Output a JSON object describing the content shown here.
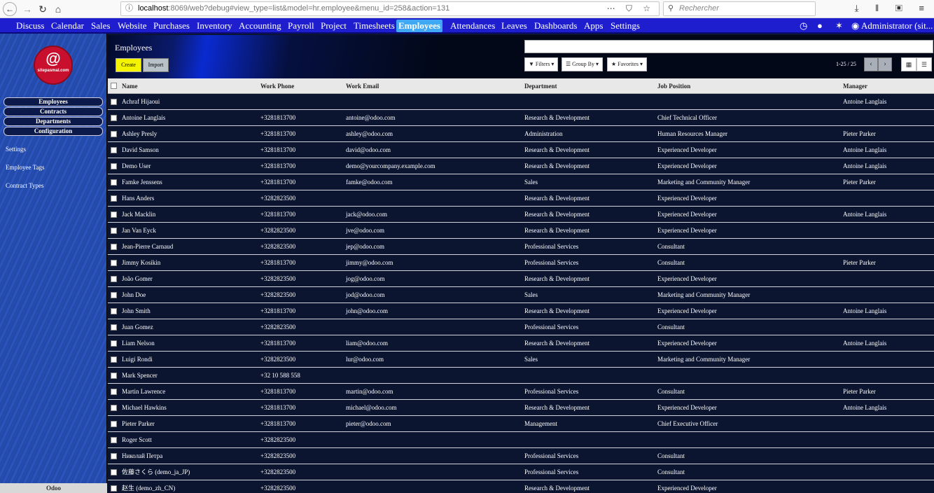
{
  "browser": {
    "url_host": "localhost",
    "url_rest": ":8069/web?debug#view_type=list&model=hr.employee&menu_id=258&action=131",
    "search_placeholder": "Rechercher",
    "urlbar_icons": "⋯ ⛉ ☆",
    "right_icons": "⤓ ‖ ▣ ≡"
  },
  "topmenu": {
    "apps": [
      "Discuss",
      "Calendar",
      "Sales",
      "Website",
      "Purchases",
      "Inventory",
      "Accounting",
      "Payroll",
      "Project",
      "Timesheets",
      "Employees",
      "Attendances",
      "Leaves",
      "Dashboards",
      "Apps",
      "Settings"
    ],
    "active": "Employees",
    "user": "Administrator (sit..."
  },
  "sidebar": {
    "logo_at": "@",
    "logo_text": "sitepasmal.com",
    "menu_buttons": [
      "Employees",
      "Contracts",
      "Departments",
      "Configuration"
    ],
    "links": [
      "Settings",
      "Employee Tags",
      "Contract Types"
    ],
    "footer": "Odoo"
  },
  "control_panel": {
    "title": "Employees",
    "create_label": "Create",
    "import_label": "Import",
    "filters_label": "▼ Filters ▾",
    "groupby_label": "☰ Group By ▾",
    "favorites_label": "★ Favorites ▾",
    "pager": "1-25 / 25",
    "prev": "‹",
    "next": "›",
    "kanban_icon": "▦",
    "list_icon": "☰"
  },
  "table": {
    "columns": [
      "Name",
      "Work Phone",
      "Work Email",
      "Department",
      "Job Position",
      "Manager"
    ],
    "rows": [
      [
        "Achraf Hijaoui",
        "",
        "",
        "",
        "",
        "Antoine Langlais"
      ],
      [
        "Antoine Langlais",
        "+3281813700",
        "antoine@odoo.com",
        "Research & Development",
        "Chief Technical Officer",
        ""
      ],
      [
        "Ashley Presly",
        "+3281813700",
        "ashley@odoo.com",
        "Administration",
        "Human Resources Manager",
        "Pieter Parker"
      ],
      [
        "David Samson",
        "+3281813700",
        "david@odoo.com",
        "Research & Development",
        "Experienced Developer",
        "Antoine Langlais"
      ],
      [
        "Demo User",
        "+3281813700",
        "demo@yourcompany.example.com",
        "Research & Development",
        "Experienced Developer",
        "Antoine Langlais"
      ],
      [
        "Famke Jenssens",
        "+3281813700",
        "famke@odoo.com",
        "Sales",
        "Marketing and Community Manager",
        "Pieter Parker"
      ],
      [
        "Hans Anders",
        "+3282823500",
        "",
        "Research & Development",
        "Experienced Developer",
        ""
      ],
      [
        "Jack Macklin",
        "+3281813700",
        "jack@odoo.com",
        "Research & Development",
        "Experienced Developer",
        "Antoine Langlais"
      ],
      [
        "Jan Van Eyck",
        "+3282823500",
        "jve@odoo.com",
        "Research & Development",
        "Experienced Developer",
        ""
      ],
      [
        "Jean-Pierre Carnaud",
        "+3282823500",
        "jep@odoo.com",
        "Professional Services",
        "Consultant",
        ""
      ],
      [
        "Jimmy Kosikin",
        "+3281813700",
        "jimmy@odoo.com",
        "Professional Services",
        "Consultant",
        "Pieter Parker"
      ],
      [
        "João Gomer",
        "+3282823500",
        "jog@odoo.com",
        "Research & Development",
        "Experienced Developer",
        ""
      ],
      [
        "John Doe",
        "+3282823500",
        "jod@odoo.com",
        "Sales",
        "Marketing and Community Manager",
        ""
      ],
      [
        "John Smith",
        "+3281813700",
        "john@odoo.com",
        "Research & Development",
        "Experienced Developer",
        "Antoine Langlais"
      ],
      [
        "Juan Gomez",
        "+3282823500",
        "",
        "Professional Services",
        "Consultant",
        ""
      ],
      [
        "Liam Nelson",
        "+3281813700",
        "liam@odoo.com",
        "Research & Development",
        "Experienced Developer",
        "Antoine Langlais"
      ],
      [
        "Luigi Rondi",
        "+3282823500",
        "lur@odoo.com",
        "Sales",
        "Marketing and Community Manager",
        ""
      ],
      [
        "Mark Spencer",
        "+32 10 588 558",
        "",
        "",
        "",
        ""
      ],
      [
        "Martin Lawrence",
        "+3281813700",
        "martin@odoo.com",
        "Professional Services",
        "Consultant",
        "Pieter Parker"
      ],
      [
        "Michael Hawkins",
        "+3281813700",
        "michael@odoo.com",
        "Research & Development",
        "Experienced Developer",
        "Antoine Langlais"
      ],
      [
        "Pieter Parker",
        "+3281813700",
        "pieter@odoo.com",
        "Management",
        "Chief Executive Officer",
        ""
      ],
      [
        "Roger Scott",
        "+3282823500",
        "",
        "",
        "",
        ""
      ],
      [
        "Николай Петра",
        "+3282823500",
        "",
        "Professional Services",
        "Consultant",
        ""
      ],
      [
        "佐藤さくら (demo_ja_JP)",
        "+3282823500",
        "",
        "Professional Services",
        "Consultant",
        ""
      ],
      [
        "赵生 (demo_zh_CN)",
        "+3282823500",
        "",
        "Research & Development",
        "Experienced Developer",
        ""
      ]
    ]
  }
}
